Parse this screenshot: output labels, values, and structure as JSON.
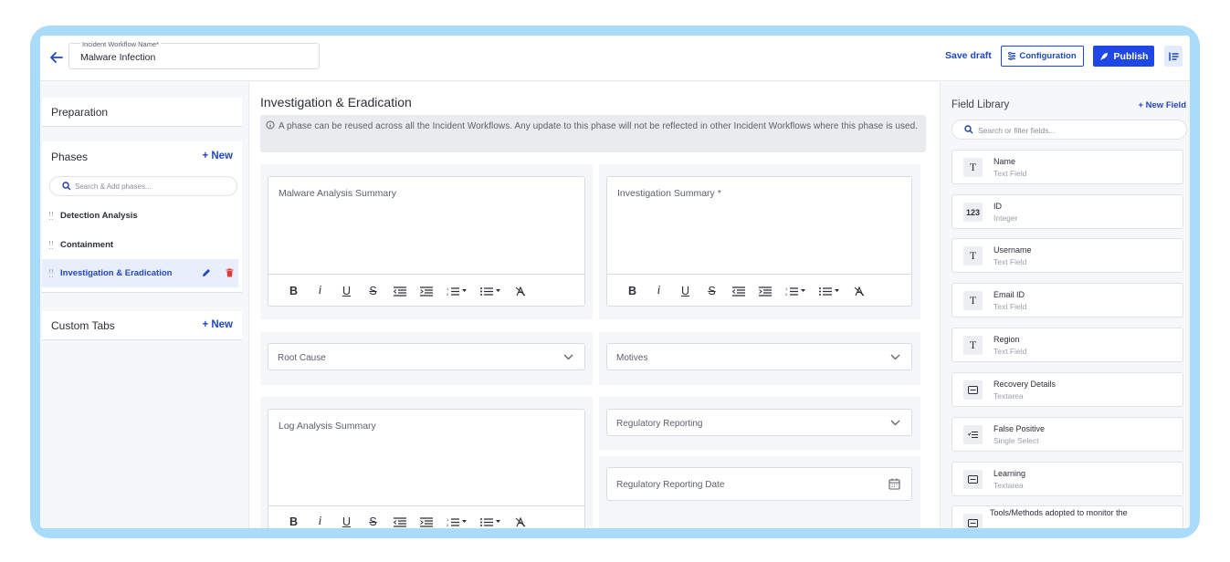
{
  "header": {
    "workflow_name_label": "Incident Workflow Name*",
    "workflow_name_value": "Malware Infection",
    "save_draft_label": "Save draft",
    "configuration_label": "Configuration",
    "publish_label": "Publish"
  },
  "sidebar": {
    "preparation_title": "Preparation",
    "phases_title": "Phases",
    "phases_new_label": "+ New",
    "phase_search_placeholder": "Search & Add phases...",
    "phases": [
      {
        "label": "Detection Analysis"
      },
      {
        "label": "Containment"
      },
      {
        "label": "Investigation & Eradication",
        "active": true
      }
    ],
    "custom_tabs_title": "Custom Tabs",
    "custom_tabs_new_label": "+ New"
  },
  "main": {
    "title": "Investigation & Eradication",
    "info_text": "A phase can be reused across all the Incident Workflows. Any update to this phase will not be reflected in other Incident Workflows where this phase is used.",
    "fields": {
      "malware_analysis_summary": "Malware Analysis Summary",
      "investigation_summary": "Investigation Summary *",
      "root_cause": "Root Cause",
      "motives": "Motives",
      "log_analysis_summary": "Log Analysis Summary",
      "regulatory_reporting": "Regulatory Reporting",
      "regulatory_reporting_date": "Regulatory Reporting Date"
    },
    "toolbar": {
      "bold": "B",
      "italic": "i",
      "underline": "U",
      "strike": "S"
    }
  },
  "field_library": {
    "title": "Field Library",
    "new_field_label": "+ New Field",
    "search_placeholder": "Search or filter fields...",
    "items": [
      {
        "name": "Name",
        "type": "Text Field",
        "icon": "T"
      },
      {
        "name": "ID",
        "type": "Integer",
        "icon": "123"
      },
      {
        "name": "Username",
        "type": "Text Field",
        "icon": "T"
      },
      {
        "name": "Email ID",
        "type": "Text Field",
        "icon": "T"
      },
      {
        "name": "Region",
        "type": "Text Field",
        "icon": "T"
      },
      {
        "name": "Recovery Details",
        "type": "Textarea",
        "icon": "textarea-icon"
      },
      {
        "name": "False Positive",
        "type": "Single Select",
        "icon": "single-select-icon"
      },
      {
        "name": "Learning",
        "type": "Textarea",
        "icon": "textarea-icon"
      },
      {
        "name": "Tools/Methods adopted to monitor the",
        "type": "",
        "icon": "textarea-icon"
      }
    ]
  },
  "colors": {
    "accent": "#1f47c6",
    "publish": "#1f47e6",
    "frame": "#a9dbfb"
  }
}
